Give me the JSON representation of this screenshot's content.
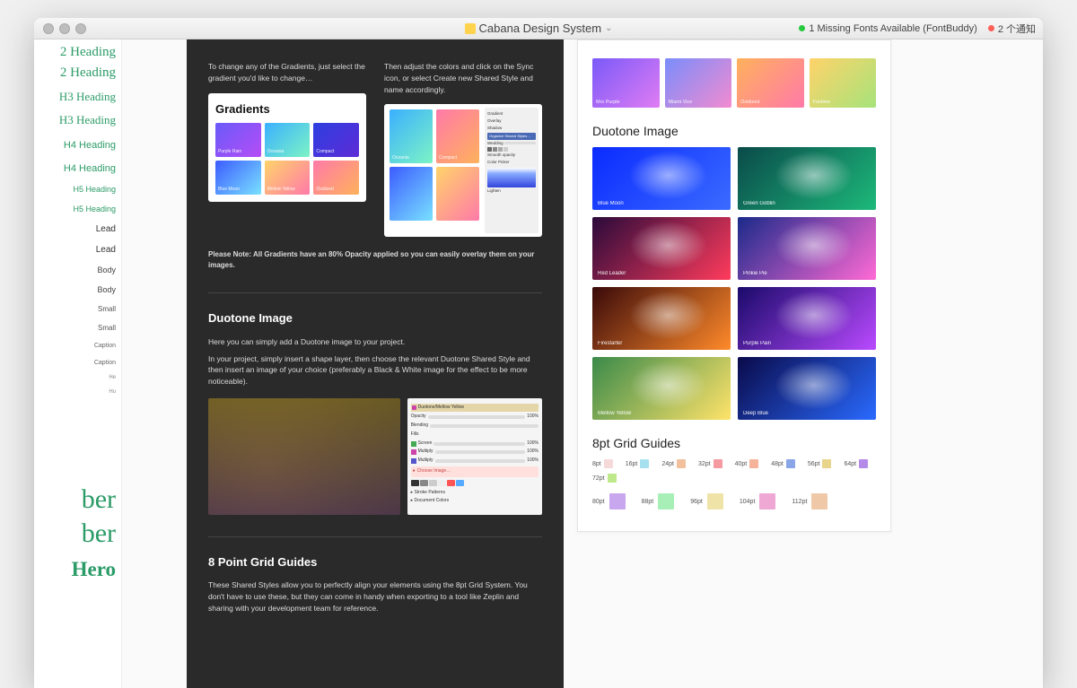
{
  "window": {
    "title": "Cabana Design System",
    "fonts_status": "1 Missing Fonts Available (FontBuddy)",
    "notifications": "2 个通知"
  },
  "typography": {
    "items": [
      "2 Heading",
      "2 Heading",
      "H3 Heading",
      "H3 Heading",
      "H4 Heading",
      "H4 Heading",
      "H5 Heading",
      "H5 Heading",
      "Lead",
      "Lead",
      "Body",
      "Body",
      "Small",
      "Small",
      "Caption",
      "Caption",
      "He",
      "Hu"
    ],
    "big1": "ber",
    "big2": "ber",
    "hero": "Hero"
  },
  "doc": {
    "intro_left": "To change any of the Gradients, just select the gradient you'd like to change…",
    "intro_right": "Then adjust the colors and click on the Sync icon, or select Create new Shared Style and name accordingly.",
    "gradients_heading": "Gradients",
    "swatches": [
      {
        "label": "Purple Rain",
        "css": "linear-gradient(135deg,#6a5af9,#b54df6)"
      },
      {
        "label": "Oceania",
        "css": "linear-gradient(135deg,#3ab0ff,#7cf3c5)"
      },
      {
        "label": "Compact",
        "css": "linear-gradient(135deg,#2d3fe0,#5e2bd6)"
      },
      {
        "label": "Blue Moon",
        "css": "linear-gradient(135deg,#3c5cff,#79e1ff)"
      },
      {
        "label": "Mellow Yellow",
        "css": "linear-gradient(135deg,#ffd36a,#ff7aa8)"
      },
      {
        "label": "Oxidized",
        "css": "linear-gradient(135deg,#ff7aa8,#ffb15c)"
      }
    ],
    "right_swatches": [
      {
        "label": "Oceania",
        "css": "linear-gradient(135deg,#3ab0ff,#7cf3c5)"
      },
      {
        "label": "Compact",
        "css": "linear-gradient(135deg,#ff7aa8,#ffb15c)"
      }
    ],
    "note": "Please Note: All Gradients have an 80% Opacity applied so you can easily overlay them on your images.",
    "duotone_heading": "Duotone Image",
    "duotone_p1": "Here you can simply add a Duotone image to your project.",
    "duotone_p2": "In your project, simply insert a shape layer, then choose the relevant Duotone Shared Style and then insert an image of your choice (preferably a Black & White image for the effect to be more noticeable).",
    "inspector": {
      "title": "Duotone/Mellow Yellow",
      "opacity": "Opacity",
      "opacity_val": "100%",
      "blending": "Blending",
      "fills": "Fills",
      "modes": [
        "Screen",
        "Multiply",
        "Multiply"
      ],
      "choose": "Choose Image…",
      "stroke": "Stroke Patterns",
      "docs": "Document Colors"
    },
    "grid_heading": "8 Point Grid Guides",
    "grid_p": "These Shared Styles allow you to perfectly align your elements using the 8pt Grid System. You don't have to use these, but they can come in handy when exporting to a tool like Zeplin and sharing with your development team for reference.",
    "mini": {
      "items": [
        "Gradient",
        "Overlay",
        "Shadow"
      ],
      "drop": "Organize Shared Styles…",
      "rows": [
        "Wedding",
        "Smooth opacity",
        "Color Picker",
        "Lighten"
      ]
    }
  },
  "right": {
    "gradients": [
      {
        "label": "Mrs Purple",
        "css": "linear-gradient(135deg,#7a5af9,#e07cf3)"
      },
      {
        "label": "Miami Vice",
        "css": "linear-gradient(135deg,#7a8dfb,#f28bd0)"
      },
      {
        "label": "Oxidized",
        "css": "linear-gradient(135deg,#ffb15c,#ff7aa8)"
      },
      {
        "label": "Funtime",
        "css": "linear-gradient(135deg,#ffd36a,#a6e37a)"
      }
    ],
    "duotone_heading": "Duotone Image",
    "duotones": [
      {
        "label": "Blue Moon",
        "bg": "linear-gradient(135deg,#0b2bff,#3a6bff)"
      },
      {
        "label": "Green Goblin",
        "bg": "linear-gradient(135deg,#0a4a4a,#1db97a)"
      },
      {
        "label": "Red Leader",
        "bg": "linear-gradient(135deg,#2a0a3a,#ff3b5c)"
      },
      {
        "label": "Pinkie Pie",
        "bg": "linear-gradient(135deg,#1a2a8a,#ff6ad5)"
      },
      {
        "label": "Firestarter",
        "bg": "linear-gradient(135deg,#3a0a0a,#ff8a2a)"
      },
      {
        "label": "Purple Pain",
        "bg": "linear-gradient(135deg,#1a0a6a,#b94aff)"
      },
      {
        "label": "Mellow Yellow",
        "bg": "linear-gradient(135deg,#3a8a4a,#ffe36a)"
      },
      {
        "label": "Deep Blue",
        "bg": "linear-gradient(135deg,#0a0a4a,#2a6aff)"
      }
    ],
    "grid_heading": "8pt Grid Guides",
    "grid_small": [
      {
        "label": "8pt",
        "color": "#f6d9d9"
      },
      {
        "label": "16pt",
        "color": "#a7e1ef"
      },
      {
        "label": "24pt",
        "color": "#f2c09d"
      },
      {
        "label": "32pt",
        "color": "#f59aa0"
      },
      {
        "label": "40pt",
        "color": "#f5b39a"
      },
      {
        "label": "48pt",
        "color": "#8aa5e8"
      },
      {
        "label": "56pt",
        "color": "#e8d48a"
      },
      {
        "label": "64pt",
        "color": "#b48ae8"
      },
      {
        "label": "72pt",
        "color": "#bfe88a"
      }
    ],
    "grid_big": [
      {
        "label": "80pt",
        "color": "#c9a7ef"
      },
      {
        "label": "88pt",
        "color": "#a7efb6"
      },
      {
        "label": "96pt",
        "color": "#efe3a7"
      },
      {
        "label": "104pt",
        "color": "#efa7d4"
      },
      {
        "label": "112pt",
        "color": "#efc9a7"
      }
    ]
  }
}
